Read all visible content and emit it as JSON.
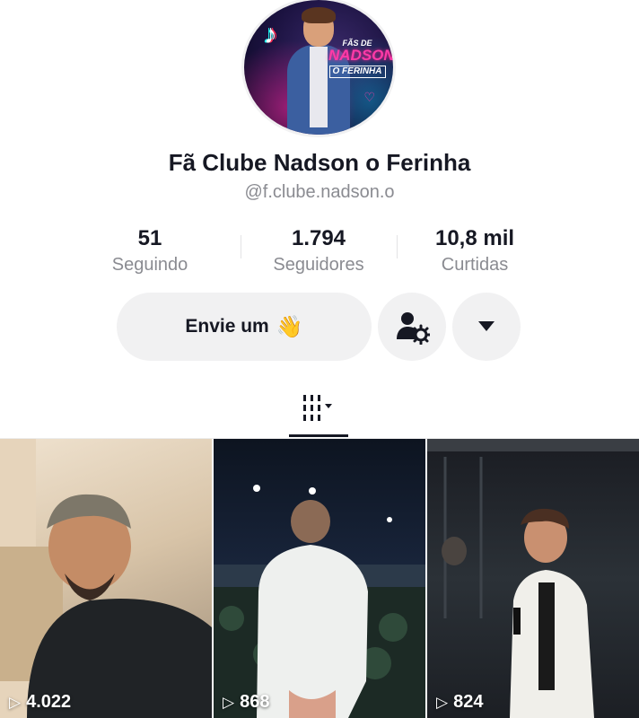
{
  "profile": {
    "avatar_badge": [
      "FÃS DE",
      "NADSON",
      "O FERINHA"
    ],
    "display_name": "Fã Clube Nadson o Ferinha",
    "username": "@f.clube.nadson.o"
  },
  "stats": [
    {
      "value": "51",
      "label": "Seguindo"
    },
    {
      "value": "1.794",
      "label": "Seguidores"
    },
    {
      "value": "10,8 mil",
      "label": "Curtidas"
    }
  ],
  "actions": {
    "message_label": "Envie um",
    "message_emoji": "👋",
    "friend_icon": "add-friend-settings-icon",
    "more_icon": "caret-down-icon"
  },
  "tabs": {
    "grid_icon": "grid-videos-icon"
  },
  "videos": [
    {
      "views": "4.022"
    },
    {
      "views": "868"
    },
    {
      "views": "824"
    }
  ],
  "colors": {
    "text": "#161823",
    "secondary_text": "#8a8b91",
    "button_bg": "#f1f1f2"
  }
}
